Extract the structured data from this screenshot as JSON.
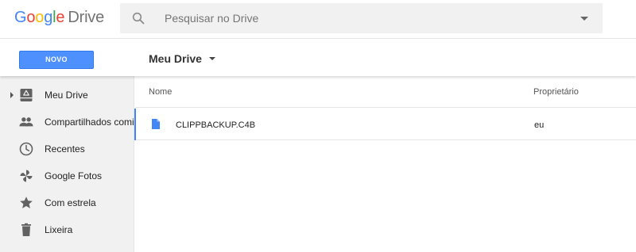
{
  "header": {
    "logo_letters": [
      "G",
      "o",
      "o",
      "g",
      "l",
      "e"
    ],
    "logo_product": "Drive",
    "search_placeholder": "Pesquisar no Drive"
  },
  "toolbar": {
    "new_label": "NOVO",
    "breadcrumb": "Meu Drive"
  },
  "sidebar": {
    "items": [
      {
        "label": "Meu Drive",
        "icon": "drive-icon"
      },
      {
        "label": "Compartilhados comigo",
        "icon": "people-icon"
      },
      {
        "label": "Recentes",
        "icon": "clock-icon"
      },
      {
        "label": "Google Fotos",
        "icon": "pinwheel-icon"
      },
      {
        "label": "Com estrela",
        "icon": "star-icon"
      },
      {
        "label": "Lixeira",
        "icon": "trash-icon"
      }
    ]
  },
  "list": {
    "columns": {
      "name": "Nome",
      "owner": "Proprietário"
    },
    "rows": [
      {
        "name": "CLIPPBACKUP.C4B",
        "owner": "eu",
        "icon": "file-icon"
      }
    ]
  },
  "colors": {
    "accent_blue": "#4285F4",
    "new_button": "#4d90fe",
    "sidebar_bg": "#f1f1f1"
  }
}
